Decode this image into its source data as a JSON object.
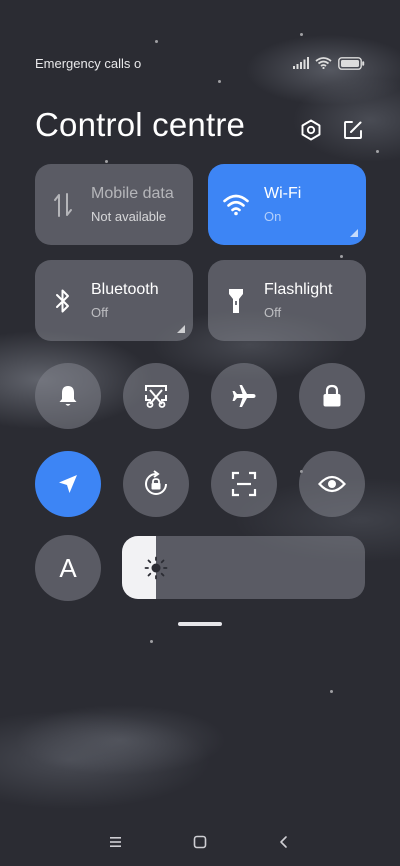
{
  "status_bar": {
    "carrier_text": "Emergency calls o",
    "icons": [
      "signal-icon",
      "wifi-icon",
      "battery-icon"
    ]
  },
  "header": {
    "title": "Control centre",
    "actions": [
      "settings-hexagon-icon",
      "edit-icon"
    ]
  },
  "tiles": [
    {
      "name": "Mobile data",
      "status": "Not available",
      "icon": "data-arrows-icon",
      "active": false
    },
    {
      "name": "Wi-Fi",
      "status": "On",
      "icon": "wifi-icon",
      "active": true
    },
    {
      "name": "Bluetooth",
      "status": "Off",
      "icon": "bluetooth-icon",
      "active": false
    },
    {
      "name": "Flashlight",
      "status": "Off",
      "icon": "flashlight-icon",
      "active": false
    }
  ],
  "toggles_row1": [
    {
      "icon": "bell-icon",
      "active": false
    },
    {
      "icon": "screenshot-scissors-icon",
      "active": false
    },
    {
      "icon": "airplane-icon",
      "active": false
    },
    {
      "icon": "lock-icon",
      "active": false
    }
  ],
  "toggles_row2": [
    {
      "icon": "location-arrow-icon",
      "active": true
    },
    {
      "icon": "rotation-lock-icon",
      "active": false
    },
    {
      "icon": "scan-frame-icon",
      "active": false
    },
    {
      "icon": "eye-icon",
      "active": false
    }
  ],
  "auto_brightness": {
    "label": "A",
    "icon": "font-size-icon"
  },
  "brightness": {
    "level": 0.14,
    "icon": "sun-icon"
  },
  "colors": {
    "accent": "#3d85f5",
    "tile": "#6e7079",
    "background": "#2b2c33"
  },
  "navigation": [
    "menu-icon",
    "home-icon",
    "back-icon"
  ]
}
